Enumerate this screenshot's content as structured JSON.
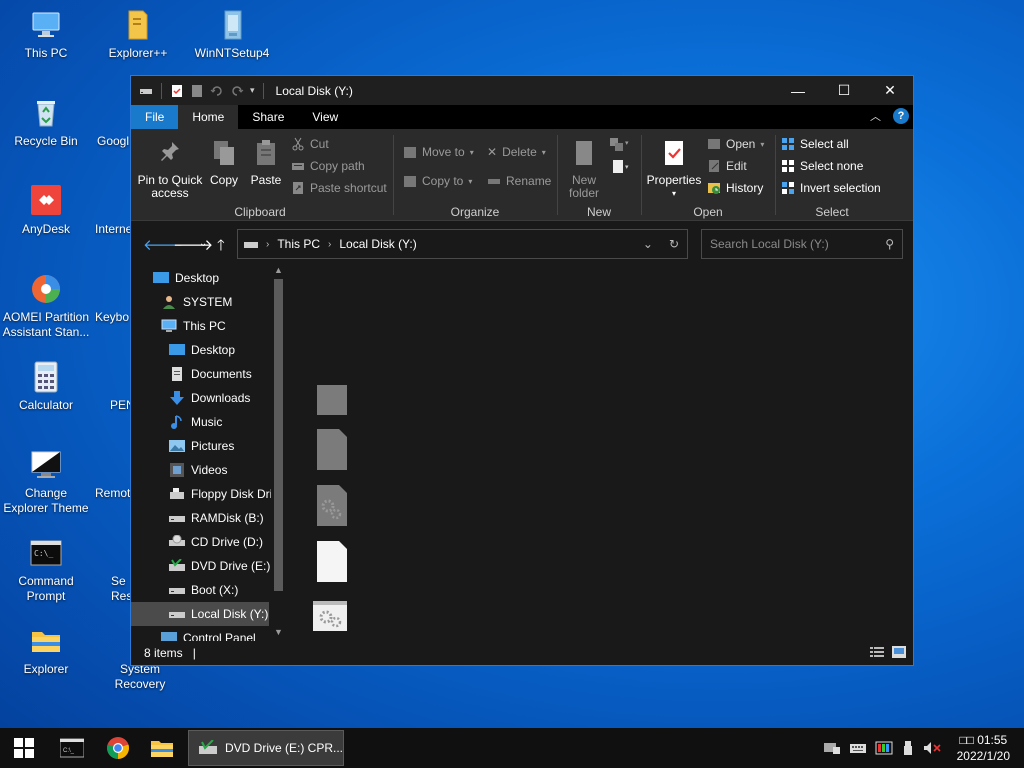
{
  "desktop": {
    "icons": [
      {
        "label": "This PC"
      },
      {
        "label": "Explorer++"
      },
      {
        "label": "WinNTSetup4"
      },
      {
        "label": "Recycle Bin"
      },
      {
        "label": "Googl"
      },
      {
        "label": "AnyDesk"
      },
      {
        "label": "Interne"
      },
      {
        "label": "AOMEI Partition Assistant Stan..."
      },
      {
        "label": "Keybo"
      },
      {
        "label": "Calculator"
      },
      {
        "label": "PEN"
      },
      {
        "label": "Change Explorer Theme"
      },
      {
        "label": "Remot"
      },
      {
        "label": "Command Prompt"
      },
      {
        "label": "Se Res"
      },
      {
        "label": "Explorer"
      },
      {
        "label": "System Recovery"
      }
    ]
  },
  "window": {
    "title": "Local Disk (Y:)",
    "controls": {
      "minimize": "—",
      "maximize": "☐",
      "close": "✕"
    },
    "tabs": [
      {
        "label": "File"
      },
      {
        "label": "Home"
      },
      {
        "label": "Share"
      },
      {
        "label": "View"
      }
    ],
    "ribbon": {
      "clipboard": {
        "label": "Clipboard",
        "pin": "Pin to Quick access",
        "pin_line1": "Pin to Quick",
        "pin_line2": "access",
        "copy": "Copy",
        "paste": "Paste",
        "cut": "Cut",
        "copy_path": "Copy path",
        "paste_shortcut": "Paste shortcut"
      },
      "organize": {
        "label": "Organize",
        "move_to": "Move to",
        "copy_to": "Copy to",
        "delete": "Delete",
        "rename": "Rename"
      },
      "new": {
        "label": "New",
        "new_folder_line1": "New",
        "new_folder_line2": "folder"
      },
      "open": {
        "label": "Open",
        "properties": "Properties",
        "open": "Open",
        "edit": "Edit",
        "history": "History"
      },
      "select": {
        "label": "Select",
        "select_all": "Select all",
        "select_none": "Select none",
        "invert": "Invert selection"
      }
    },
    "address": {
      "crumbs": [
        "This PC",
        "Local Disk (Y:)"
      ],
      "search_placeholder": "Search Local Disk (Y:)"
    },
    "nav": [
      {
        "label": "Desktop"
      },
      {
        "label": "SYSTEM"
      },
      {
        "label": "This PC"
      },
      {
        "label": "Desktop"
      },
      {
        "label": "Documents"
      },
      {
        "label": "Downloads"
      },
      {
        "label": "Music"
      },
      {
        "label": "Pictures"
      },
      {
        "label": "Videos"
      },
      {
        "label": "Floppy Disk Dri"
      },
      {
        "label": "RAMDisk (B:)"
      },
      {
        "label": "CD Drive (D:)"
      },
      {
        "label": "DVD Drive (E:) C"
      },
      {
        "label": "Boot (X:)"
      },
      {
        "label": "Local Disk (Y:)"
      },
      {
        "label": "Control Panel"
      }
    ],
    "status": {
      "items": "8 items",
      "cursor": "|"
    }
  },
  "taskbar": {
    "active_app": "DVD Drive (E:) CPR...",
    "clock": {
      "time": "□□ 01:55",
      "date": "2022/1/20"
    }
  }
}
